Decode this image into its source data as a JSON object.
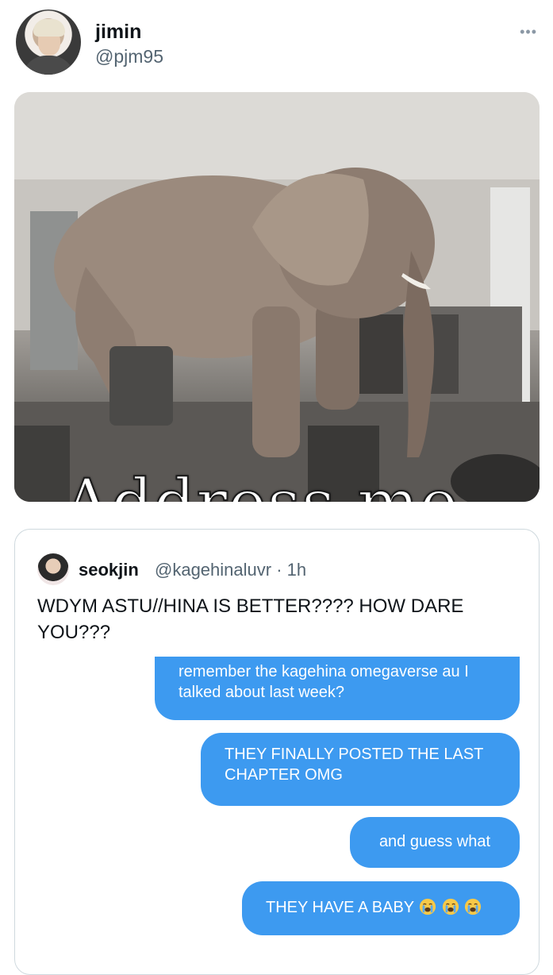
{
  "tweet": {
    "author_name": "jimin",
    "author_handle": "@pjm95",
    "more_icon": "more-horizontal-icon",
    "media_caption": "Address me"
  },
  "quoted_tweet": {
    "author_name": "seokjin",
    "author_handle": "@kagehinaluvr · 1h",
    "text": "WDYM ASTU//HINA IS BETTER???? HOW DARE YOU???",
    "messages": [
      "remember the kagehina omegaverse au I talked about last week?",
      "THEY FINALLY POSTED THE LAST CHAPTER OMG",
      "and guess what",
      "THEY HAVE A BABY"
    ],
    "last_message_emojis": [
      "crying-face-emoji",
      "crying-face-emoji",
      "crying-face-emoji"
    ]
  },
  "colors": {
    "bubble": "#3d9af0",
    "handle": "#536471",
    "border": "#cfd9de"
  }
}
